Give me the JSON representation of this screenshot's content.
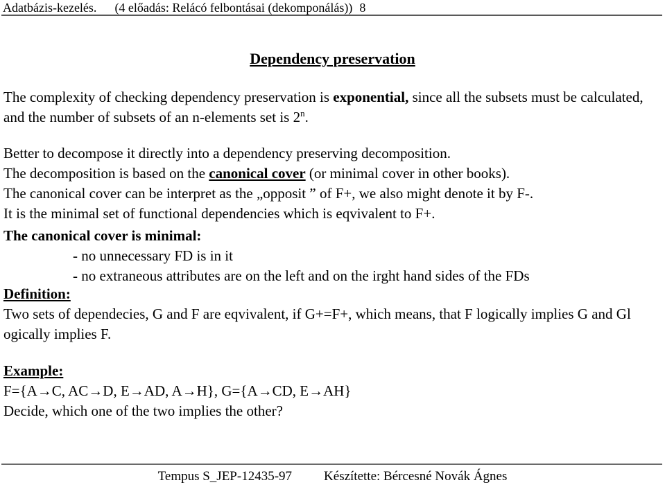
{
  "header": {
    "course": "Adatbázis-kezelés.",
    "topic": "(4 előadás: Relácó felbontásai (dekomponálás))",
    "page_number": "8"
  },
  "title": "Dependency preservation",
  "content": {
    "intro": {
      "line1_a": "The complexity of checking dependency preservation is ",
      "line1_bold": "exponential,",
      "line1_b": " since all the subsets must be calculated, and the number of subsets of an n-elements set is 2",
      "line1_sup": "n",
      "line1_c": "."
    },
    "middle": {
      "line1": "Better to decompose it directly into a dependency preserving decomposition.",
      "line2_a": "The  decomposition is based on the ",
      "line2_bold_underline": "canonical cover",
      "line2_b": " (or minimal cover in other books).",
      "line3": "The canonical cover can be interpret as the „opposit ” of F+, we also might denote it by F-.",
      "line4": "It is the minimal set of functional dependencies which is eqvivalent to F+."
    },
    "minimal": {
      "heading": "The canonical cover is minimal:",
      "bullets": [
        "- no unnecessary FD is in it",
        "- no extraneous attributes are on the left and on the irght hand sides of the FDs"
      ]
    },
    "definition": {
      "heading": "Definition:",
      "body": "Two sets of dependecies, G and F are  eqvivalent, if  G+=F+, which means, that F logically implies G and Gl ogically implies F."
    },
    "example": {
      "heading": "Example:",
      "formula": "F={A→C, AC→D, E→AD, A→H}, G={A→CD, E→AH}",
      "question": "Decide, which one of the two implies the other?"
    }
  },
  "footer": {
    "project": "Tempus S_JEP-12435-97",
    "author": "Készítette: Bércesné Novák Ágnes"
  },
  "colors": {
    "text": "#000000",
    "rule": "#5a5a5a",
    "background": "#ffffff"
  }
}
